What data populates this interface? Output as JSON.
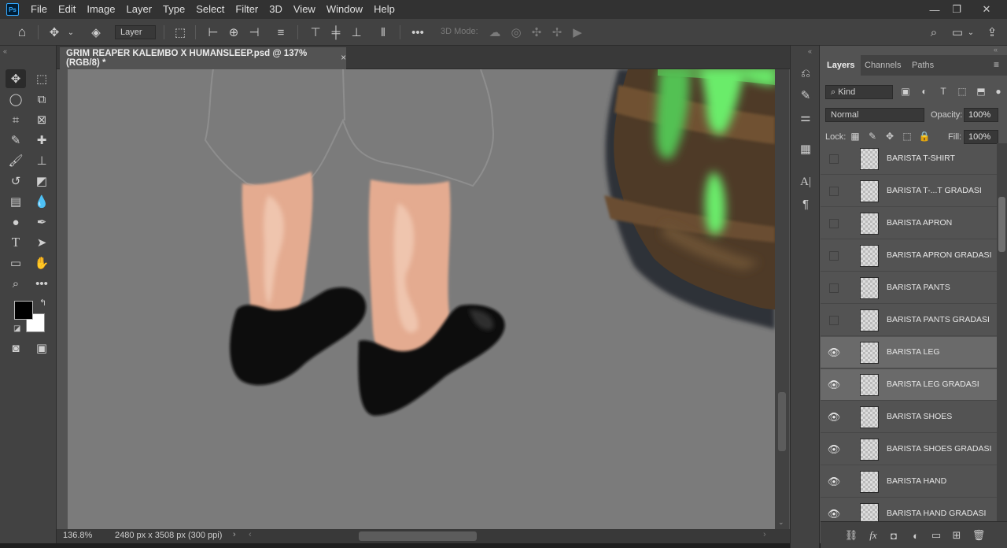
{
  "app": {
    "logo": "Ps"
  },
  "menu": [
    "File",
    "Edit",
    "Image",
    "Layer",
    "Type",
    "Select",
    "Filter",
    "3D",
    "View",
    "Window",
    "Help"
  ],
  "window_controls": {
    "minimize": "—",
    "restore": "❐",
    "close": "✕"
  },
  "options_bar": {
    "layer_select": "Layer",
    "mode_3d_label": "3D Mode:"
  },
  "document": {
    "tab_title": "GRIM REAPER KALEMBO X HUMANSLEEP.psd @ 137% (RGB/8) *",
    "close": "×"
  },
  "status": {
    "zoom": "136.8%",
    "doc_info": "2480 px x 3508 px (300 ppi)"
  },
  "colors": {
    "foreground": "#000000",
    "background": "#ffffff",
    "accent": "#31a8ff"
  },
  "layers_panel": {
    "tabs": [
      "Layers",
      "Channels",
      "Paths"
    ],
    "filter_kind": "Kind",
    "blend_mode": "Normal",
    "opacity_label": "Opacity:",
    "opacity_value": "100%",
    "lock_label": "Lock:",
    "fill_label": "Fill:",
    "fill_value": "100%",
    "layers": [
      {
        "name": "BARISTA T-SHIRT",
        "visible": false,
        "selected": false
      },
      {
        "name": "BARISTA T-...T GRADASI",
        "visible": false,
        "selected": false
      },
      {
        "name": "BARISTA APRON",
        "visible": false,
        "selected": false
      },
      {
        "name": "BARISTA APRON GRADASI",
        "visible": false,
        "selected": false
      },
      {
        "name": "BARISTA PANTS",
        "visible": false,
        "selected": false
      },
      {
        "name": "BARISTA PANTS GRADASI",
        "visible": false,
        "selected": false
      },
      {
        "name": "BARISTA LEG",
        "visible": true,
        "selected": true
      },
      {
        "name": "BARISTA LEG GRADASI",
        "visible": true,
        "selected": true
      },
      {
        "name": "BARISTA SHOES",
        "visible": true,
        "selected": false
      },
      {
        "name": "BARISTA SHOES GRADASI",
        "visible": true,
        "selected": false
      },
      {
        "name": "BARISTA HAND",
        "visible": true,
        "selected": false
      },
      {
        "name": "BARISTA HAND GRADASI",
        "visible": true,
        "selected": false
      }
    ]
  }
}
